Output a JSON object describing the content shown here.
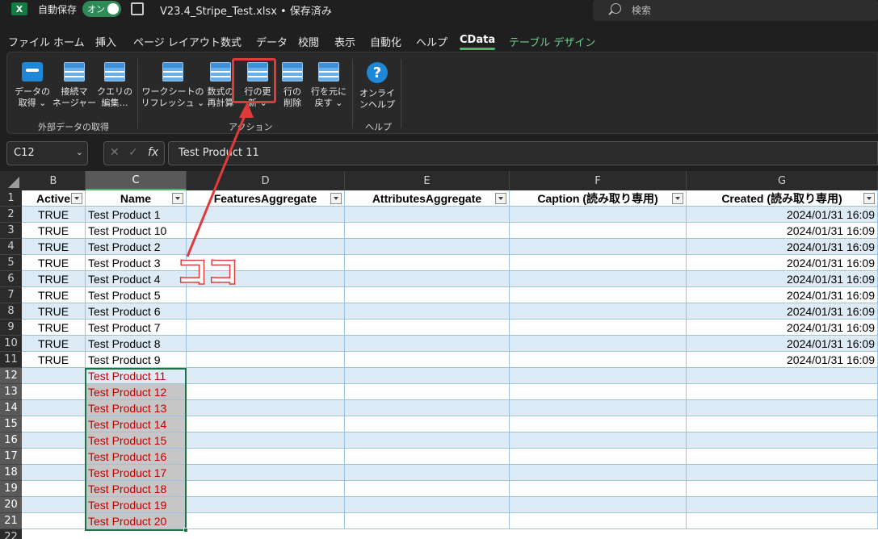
{
  "titlebar": {
    "app_logo": "X",
    "autosave_label": "自動保存",
    "autosave_state": "オン",
    "file_title": "V23.4_Stripe_Test.xlsx • 保存済み",
    "chevron": "⌄",
    "search_placeholder": "検索"
  },
  "menu": {
    "tabs": [
      "ファイル",
      "ホーム",
      "挿入",
      "ページ レイアウト",
      "数式",
      "データ",
      "校閲",
      "表示",
      "自動化",
      "ヘルプ",
      "CData",
      "テーブル デザイン"
    ],
    "active_tab": "CData"
  },
  "ribbon": {
    "buttons": [
      {
        "label": "データの\n取得 ⌄",
        "icon": "odata-icon"
      },
      {
        "label": "接続マ\nネージャー",
        "icon": "table-icon"
      },
      {
        "label": "クエリの\n編集…",
        "icon": "table-edit-icon"
      },
      {
        "label": "ワークシートの\nリフレッシュ ⌄",
        "icon": "refresh-icon"
      },
      {
        "label": "数式の\n再計算",
        "icon": "recalc-icon"
      },
      {
        "label": "行の更\n新 ⌄",
        "icon": "update-row-icon"
      },
      {
        "label": "行の\n削除",
        "icon": "delete-row-icon"
      },
      {
        "label": "行を元に\n戻す ⌄",
        "icon": "revert-row-icon"
      },
      {
        "label": "オンライ\nンヘルプ",
        "icon": "help-icon"
      }
    ],
    "help_glyph": "?",
    "groups": [
      "外部データの取得",
      "アクション",
      "ヘルプ"
    ]
  },
  "formula_bar": {
    "name_box": "C12",
    "name_chevron": "⌄",
    "cancel": "✕",
    "enter": "✓",
    "fx": "fx",
    "value": "Test Product 11"
  },
  "grid": {
    "columns": [
      "B",
      "C",
      "D",
      "E",
      "F",
      "G"
    ],
    "selected_column": "C",
    "row_numbers": [
      "1",
      "2",
      "3",
      "4",
      "5",
      "6",
      "7",
      "8",
      "9",
      "10",
      "11",
      "12",
      "13",
      "14",
      "15",
      "16",
      "17",
      "18",
      "19",
      "20",
      "21",
      "22"
    ],
    "headers": [
      "Active",
      "Name",
      "FeaturesAggregate",
      "AttributesAggregate",
      "Caption (読み取り専用)",
      "Created (読み取り専用)"
    ],
    "rows": [
      {
        "active": "TRUE",
        "name": "Test Product 1",
        "created": "2024/01/31 16:09"
      },
      {
        "active": "TRUE",
        "name": "Test Product 10",
        "created": "2024/01/31 16:09"
      },
      {
        "active": "TRUE",
        "name": "Test Product 2",
        "created": "2024/01/31 16:09"
      },
      {
        "active": "TRUE",
        "name": "Test Product 3",
        "created": "2024/01/31 16:09"
      },
      {
        "active": "TRUE",
        "name": "Test Product 4",
        "created": "2024/01/31 16:09"
      },
      {
        "active": "TRUE",
        "name": "Test Product 5",
        "created": "2024/01/31 16:09"
      },
      {
        "active": "TRUE",
        "name": "Test Product 6",
        "created": "2024/01/31 16:09"
      },
      {
        "active": "TRUE",
        "name": "Test Product 7",
        "created": "2024/01/31 16:09"
      },
      {
        "active": "TRUE",
        "name": "Test Product 8",
        "created": "2024/01/31 16:09"
      },
      {
        "active": "TRUE",
        "name": "Test Product 9",
        "created": "2024/01/31 16:09"
      },
      {
        "active": "",
        "name": "Test Product 11",
        "created": ""
      },
      {
        "active": "",
        "name": "Test Product 12",
        "created": ""
      },
      {
        "active": "",
        "name": "Test Product 13",
        "created": ""
      },
      {
        "active": "",
        "name": "Test Product 14",
        "created": ""
      },
      {
        "active": "",
        "name": "Test Product 15",
        "created": ""
      },
      {
        "active": "",
        "name": "Test Product 16",
        "created": ""
      },
      {
        "active": "",
        "name": "Test Product 17",
        "created": ""
      },
      {
        "active": "",
        "name": "Test Product 18",
        "created": ""
      },
      {
        "active": "",
        "name": "Test Product 19",
        "created": ""
      },
      {
        "active": "",
        "name": "Test Product 20",
        "created": ""
      }
    ]
  },
  "annotation": {
    "text": "ココ",
    "color": "#e03b3b"
  },
  "colors": {
    "accent_green": "#4db86d",
    "band_blue": "#ddebf7",
    "new_row_text": "#c00000"
  }
}
